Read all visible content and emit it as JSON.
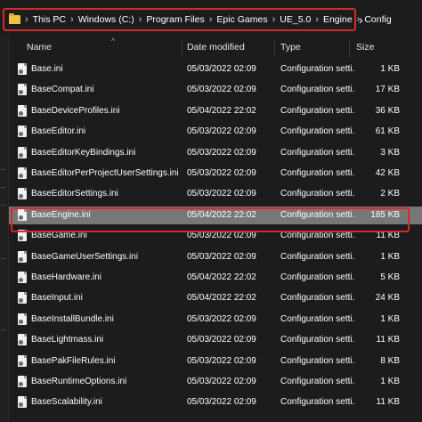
{
  "address_bar": {
    "folder_icon": "folder-icon",
    "crumbs": [
      "This PC",
      "Windows (C:)",
      "Program Files",
      "Epic Games",
      "UE_5.0",
      "Engine",
      "Config"
    ],
    "separator": "›",
    "expand_glyph": "›",
    "highlight_color": "#d42a2a"
  },
  "columns": {
    "name": "Name",
    "date": "Date modified",
    "type": "Type",
    "size": "Size",
    "sort_caret": "^"
  },
  "files": [
    {
      "name": "Base.ini",
      "date": "05/03/2022 02:09",
      "type": "Configuration setti...",
      "size": "1 KB"
    },
    {
      "name": "BaseCompat.ini",
      "date": "05/03/2022 02:09",
      "type": "Configuration setti...",
      "size": "17 KB"
    },
    {
      "name": "BaseDeviceProfiles.ini",
      "date": "05/04/2022 22:02",
      "type": "Configuration setti...",
      "size": "36 KB"
    },
    {
      "name": "BaseEditor.ini",
      "date": "05/03/2022 02:09",
      "type": "Configuration setti...",
      "size": "61 KB"
    },
    {
      "name": "BaseEditorKeyBindings.ini",
      "date": "05/03/2022 02:09",
      "type": "Configuration setti...",
      "size": "3 KB"
    },
    {
      "name": "BaseEditorPerProjectUserSettings.ini",
      "date": "05/03/2022 02:09",
      "type": "Configuration setti...",
      "size": "42 KB"
    },
    {
      "name": "BaseEditorSettings.ini",
      "date": "05/03/2022 02:09",
      "type": "Configuration setti...",
      "size": "2 KB"
    },
    {
      "name": "BaseEngine.ini",
      "date": "05/04/2022 22:02",
      "type": "Configuration setti...",
      "size": "185 KB",
      "selected": true
    },
    {
      "name": "BaseGame.ini",
      "date": "05/03/2022 02:09",
      "type": "Configuration setti...",
      "size": "11 KB"
    },
    {
      "name": "BaseGameUserSettings.ini",
      "date": "05/03/2022 02:09",
      "type": "Configuration setti...",
      "size": "1 KB"
    },
    {
      "name": "BaseHardware.ini",
      "date": "05/04/2022 22:02",
      "type": "Configuration setti...",
      "size": "5 KB"
    },
    {
      "name": "BaseInput.ini",
      "date": "05/04/2022 22:02",
      "type": "Configuration setti...",
      "size": "24 KB"
    },
    {
      "name": "BaseInstallBundle.ini",
      "date": "05/03/2022 02:09",
      "type": "Configuration setti...",
      "size": "1 KB"
    },
    {
      "name": "BaseLightmass.ini",
      "date": "05/03/2022 02:09",
      "type": "Configuration setti...",
      "size": "11 KB"
    },
    {
      "name": "BasePakFileRules.ini",
      "date": "05/03/2022 02:09",
      "type": "Configuration setti...",
      "size": "8 KB"
    },
    {
      "name": "BaseRuntimeOptions.ini",
      "date": "05/03/2022 02:09",
      "type": "Configuration setti...",
      "size": "1 KB"
    },
    {
      "name": "BaseScalability.ini",
      "date": "05/03/2022 02:09",
      "type": "Configuration setti...",
      "size": "11 KB"
    }
  ]
}
